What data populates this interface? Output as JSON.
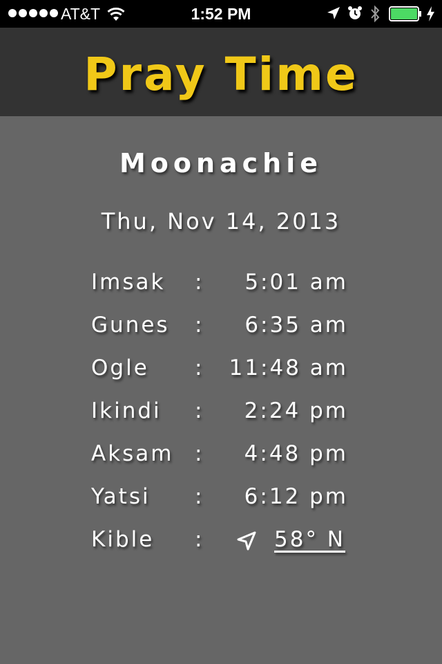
{
  "status_bar": {
    "carrier": "AT&T",
    "time": "1:52 PM",
    "signal_bars": 5,
    "battery_level": 1.0,
    "icons": [
      "signal-dots",
      "wifi-icon",
      "location-arrow-icon",
      "alarm-icon",
      "bluetooth-icon",
      "battery-icon",
      "charging-icon"
    ]
  },
  "header": {
    "title": "Pray Time"
  },
  "location": {
    "city": "Moonachie",
    "date": "Thu, Nov 14, 2013"
  },
  "prayer_times": [
    {
      "name": "Imsak",
      "separator": ":",
      "time": "5:01 am"
    },
    {
      "name": "Gunes",
      "separator": ":",
      "time": "6:35 am"
    },
    {
      "name": "Ogle",
      "separator": ":",
      "time": "11:48 am"
    },
    {
      "name": "Ikindi",
      "separator": ":",
      "time": "2:24 pm"
    },
    {
      "name": "Aksam",
      "separator": ":",
      "time": "4:48 pm"
    },
    {
      "name": "Yatsi",
      "separator": ":",
      "time": "6:12 pm"
    }
  ],
  "kible": {
    "name": "Kible",
    "separator": ":",
    "direction": "58° N",
    "icon": "navigation-arrow-icon"
  },
  "colors": {
    "title": "#f0c818",
    "header_bg": "#333333",
    "content_bg": "#666666",
    "battery": "#4cd964"
  }
}
